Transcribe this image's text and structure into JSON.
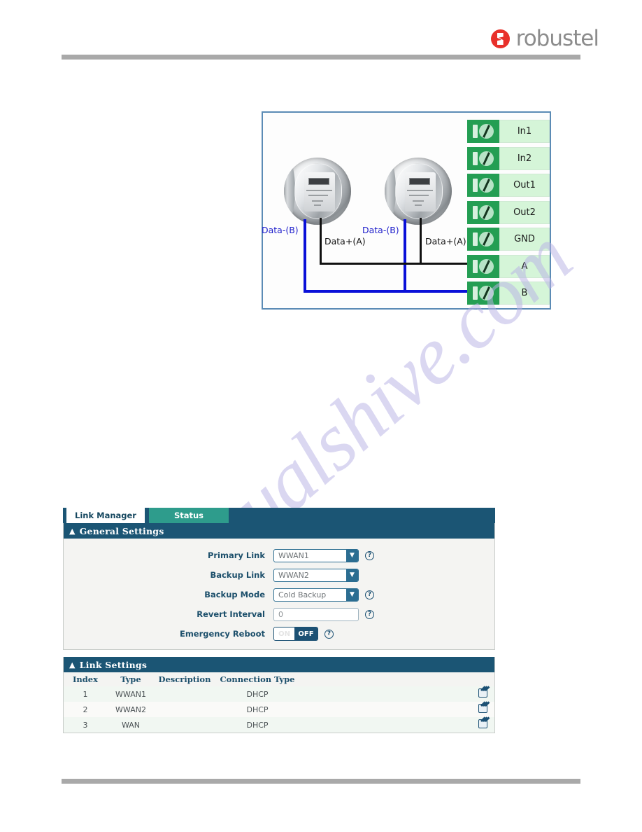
{
  "brand": {
    "logo_text": "robustel",
    "logo_icon": "robustel-logo-icon",
    "accent_red": "#e8302a",
    "logo_gray": "#8c8c8c"
  },
  "watermark": {
    "text": "manualshive.com",
    "color": "#b9b3e6"
  },
  "diagram": {
    "name": "rs485-meter-wiring-diagram",
    "border_color": "#5b8bb5",
    "terminals": [
      {
        "label": "In1"
      },
      {
        "label": "In2"
      },
      {
        "label": "Out1"
      },
      {
        "label": "Out2"
      },
      {
        "label": "GND"
      },
      {
        "label": "A"
      },
      {
        "label": "B"
      }
    ],
    "wire_labels": [
      {
        "text": "Data-(B)",
        "color": "#2222cc"
      },
      {
        "text": "Data+(A)",
        "color": "#111111"
      },
      {
        "text": "Data-(B)",
        "color": "#2222cc"
      },
      {
        "text": "Data+(A)",
        "color": "#111111"
      }
    ],
    "meters": [
      {
        "name": "electric-meter-1"
      },
      {
        "name": "electric-meter-2"
      }
    ],
    "colors": {
      "terminal_green": "#249e53",
      "terminal_label_green": "#d5f5d8",
      "wire_black": "#111111",
      "wire_blue": "#0a10d8"
    }
  },
  "webui": {
    "tabs": [
      {
        "label": "Link Manager",
        "active": true
      },
      {
        "label": "Status",
        "active": false
      }
    ],
    "general_settings": {
      "title": "General Settings",
      "fields": [
        {
          "label": "Primary Link",
          "kind": "select",
          "value": "WWAN1",
          "help": true
        },
        {
          "label": "Backup Link",
          "kind": "select",
          "value": "WWAN2",
          "help": false
        },
        {
          "label": "Backup Mode",
          "kind": "select",
          "value": "Cold Backup",
          "help": true
        },
        {
          "label": "Revert Interval",
          "kind": "text",
          "value": "0",
          "help": true
        },
        {
          "label": "Emergency Reboot",
          "kind": "toggle",
          "value": "OFF",
          "on_label": "ON",
          "help": true
        }
      ]
    },
    "link_settings": {
      "title": "Link Settings",
      "columns": [
        "Index",
        "Type",
        "Description",
        "Connection Type"
      ],
      "rows": [
        {
          "index": "1",
          "type": "WWAN1",
          "description": "",
          "connection_type": "DHCP",
          "edit": "edit-icon"
        },
        {
          "index": "2",
          "type": "WWAN2",
          "description": "",
          "connection_type": "DHCP",
          "edit": "edit-icon"
        },
        {
          "index": "3",
          "type": "WAN",
          "description": "",
          "connection_type": "DHCP",
          "edit": "edit-icon"
        }
      ]
    },
    "colors": {
      "header_blue": "#1b5574",
      "tab_teal": "#2e9c8c",
      "label_blue": "#1c4f6b"
    }
  }
}
